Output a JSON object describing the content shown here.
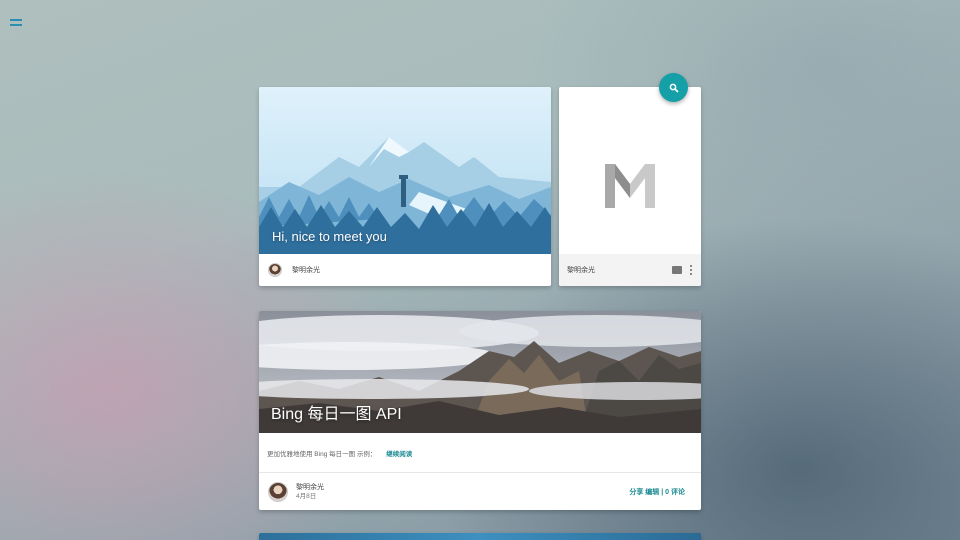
{
  "nav": {
    "menu_icon": "menu-icon"
  },
  "search": {
    "icon": "search-icon",
    "color": "#15a0a8"
  },
  "cards": {
    "hero": {
      "title": "Hi, nice to meet you",
      "author": "黎明余光"
    },
    "m_card": {
      "logo": "m-logo",
      "author": "黎明余光",
      "icons": [
        "film-icon",
        "more-vert-icon"
      ]
    },
    "bing": {
      "title": "Bing 每日一图 API",
      "description": "更加优雅地使用 Bing 每日一图 示例：",
      "read_more": "继续阅读",
      "author": "黎明余光",
      "date": "4月8日",
      "share": "分享",
      "edit": "编辑",
      "separator": "|",
      "comments": "0 评论"
    }
  },
  "colors": {
    "accent": "#15a0a8",
    "link": "#1b8a92"
  }
}
